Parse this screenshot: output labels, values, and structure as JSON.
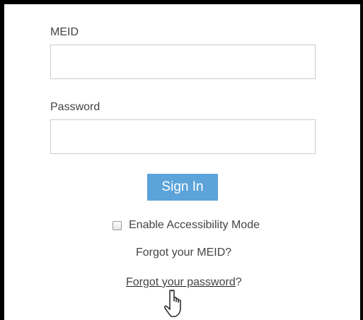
{
  "login_form": {
    "meid_label": "MEID",
    "meid_value": "",
    "password_label": "Password",
    "password_value": "",
    "sign_in_label": "Sign In",
    "accessibility_label": "Enable Accessibility Mode",
    "accessibility_checked": false,
    "forgot_meid_label": "Forgot your MEID?",
    "forgot_password_link_text": "Forgot your password",
    "forgot_password_suffix": "?"
  },
  "cursor": {
    "icon": "hand-pointer-icon"
  },
  "colors": {
    "button_bg": "#5ba3d9",
    "button_text": "#ffffff",
    "input_border": "#cccccc",
    "text": "#444444",
    "frame_border": "#000000"
  }
}
